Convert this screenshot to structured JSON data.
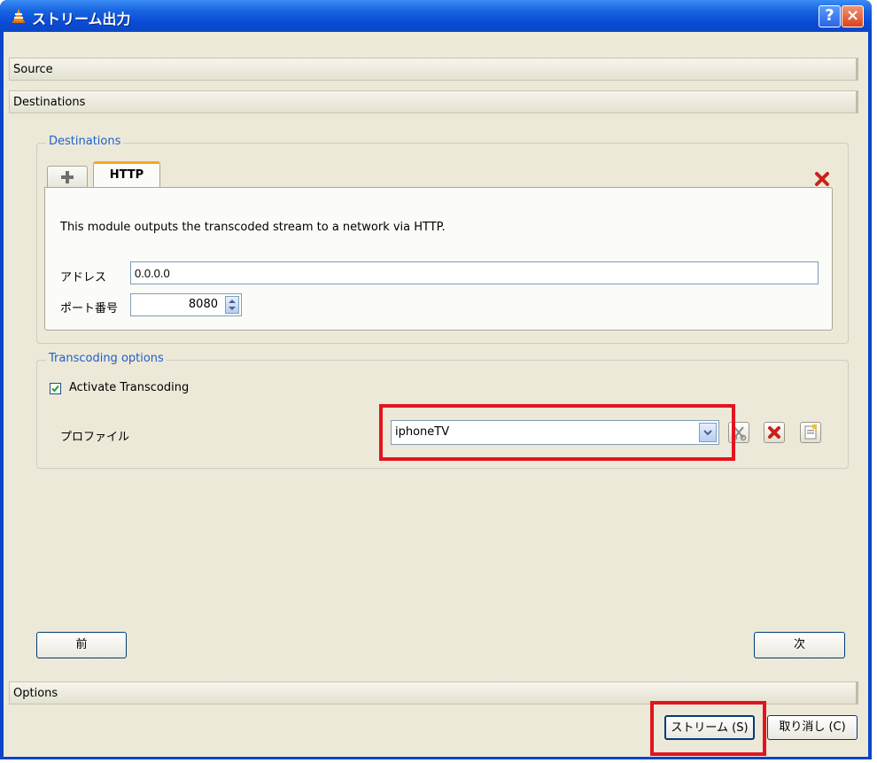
{
  "window": {
    "title": "ストリーム出力",
    "help_label": "?",
    "close_label": "×"
  },
  "sections": {
    "source": "Source",
    "destinations": "Destinations",
    "options": "Options"
  },
  "destinations_group": {
    "title": "Destinations",
    "tabs": [
      {
        "label": "+",
        "icon": "plus-icon"
      },
      {
        "label": "HTTP",
        "active": true
      }
    ],
    "remove_icon": "remove-tab-icon",
    "description": "This module outputs the transcoded stream to a network via HTTP.",
    "address_label": "アドレス",
    "address_value": "0.0.0.0",
    "port_label": "ポート番号",
    "port_value": "8080"
  },
  "transcoding_group": {
    "title": "Transcoding options",
    "activate_label": "Activate Transcoding",
    "activate_checked": true,
    "profile_label": "プロファイル",
    "profile_value": "iphoneTV",
    "icons": [
      "edit-profile-icon",
      "delete-profile-icon",
      "new-profile-icon"
    ]
  },
  "nav": {
    "prev_label": "前",
    "next_label": "次"
  },
  "buttons": {
    "stream_label": "ストリーム (S)",
    "cancel_label": "取り消し (C)"
  },
  "colors": {
    "highlight": "#e3141f",
    "group_title": "#1f5fc8",
    "titlebar": "#0a4cd6"
  }
}
